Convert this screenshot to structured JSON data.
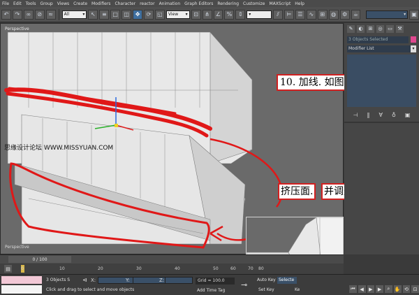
{
  "menubar": {
    "items": [
      "File",
      "Edit",
      "Tools",
      "Group",
      "Views",
      "Create",
      "Modifiers",
      "Character",
      "reactor",
      "Animation",
      "Graph Editors",
      "Rendering",
      "Customize",
      "MAXScript",
      "Help"
    ]
  },
  "toolbar": {
    "selection_filter": "All",
    "reference_coord": "View",
    "icons": [
      "undo-icon",
      "redo-icon",
      "link-icon",
      "unlink-icon",
      "bind-icon",
      "select-icon",
      "select-name-icon",
      "region-icon",
      "crossing-icon",
      "move-icon",
      "rotate-icon",
      "scale-icon",
      "pivot-icon",
      "snap-icon",
      "angle-snap-icon",
      "percent-snap-icon",
      "spinner-snap-icon",
      "mirror-icon",
      "align-icon",
      "layers-icon",
      "curve-icon",
      "schematic-icon",
      "material-icon",
      "render-setup-icon",
      "render-icon"
    ]
  },
  "viewport": {
    "label": "Perspective",
    "label_bottom": "Perspective"
  },
  "command_panel": {
    "selection_text": "3 Objects Selected",
    "modifier_list_label": "Modifier List",
    "swatch_color": "#e0488f"
  },
  "annotations": {
    "step_title": "10. 加线. 如图",
    "action_part1": "挤压面.",
    "action_part2": "并调整"
  },
  "watermark": "思缘设计论坛 WWW.MISSYUAN.COM",
  "timeline": {
    "position": "0 / 100",
    "ticks": [
      "0",
      "10",
      "20",
      "30",
      "40",
      "50",
      "60",
      "70",
      "80"
    ]
  },
  "statusbar": {
    "objects_selected": "3 Objects S",
    "prompt": "Click and drag to select and move objects",
    "x_label": "X:",
    "y_label": "Y:",
    "z_label": "Z:",
    "grid": "Grid = 100.0",
    "add_time_tag": "Add Time Tag",
    "auto_key": "Auto Key",
    "auto_key_mode": "Selecte",
    "set_key": "Set Key",
    "key_filters": "Ke"
  },
  "colors": {
    "annotation_red": "#d12020",
    "object_face": "#e8e8e8",
    "viewport_bg": "#6a6a6a"
  }
}
